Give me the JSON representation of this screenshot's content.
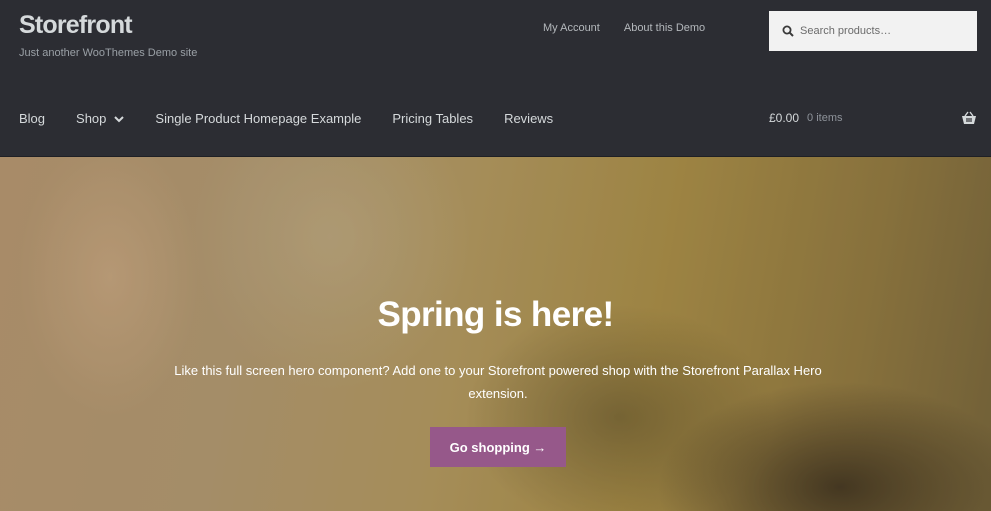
{
  "site": {
    "title": "Storefront",
    "tagline": "Just another WooThemes Demo site"
  },
  "secondary_nav": [
    {
      "label": "My Account"
    },
    {
      "label": "About this Demo"
    }
  ],
  "search": {
    "placeholder": "Search products…",
    "icon": "search-icon"
  },
  "primary_nav": [
    {
      "label": "Blog"
    },
    {
      "label": "Shop",
      "has_dropdown": true
    },
    {
      "label": "Single Product Homepage Example"
    },
    {
      "label": "Pricing Tables"
    },
    {
      "label": "Reviews"
    }
  ],
  "cart": {
    "amount": "£0.00",
    "count": "0 items",
    "icon": "basket-icon"
  },
  "hero": {
    "title": "Spring is here!",
    "text": "Like this full screen hero component? Add one to your Storefront powered shop with the Storefront Parallax Hero extension.",
    "button_label": "Go shopping →"
  },
  "colors": {
    "header_bg": "#2c2d33",
    "accent": "#96588a",
    "header_text": "#d5d9db"
  }
}
